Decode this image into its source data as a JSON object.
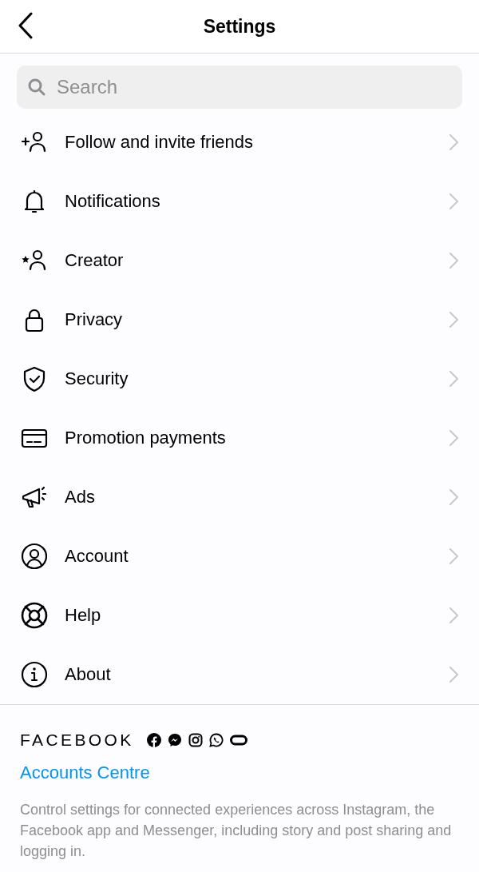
{
  "header": {
    "title": "Settings"
  },
  "search": {
    "placeholder": "Search"
  },
  "items": [
    {
      "label": "Follow and invite friends"
    },
    {
      "label": "Notifications"
    },
    {
      "label": "Creator"
    },
    {
      "label": "Privacy"
    },
    {
      "label": "Security"
    },
    {
      "label": "Promotion payments"
    },
    {
      "label": "Ads"
    },
    {
      "label": "Account"
    },
    {
      "label": "Help"
    },
    {
      "label": "About"
    }
  ],
  "footer": {
    "brand": "FACEBOOK",
    "link": "Accounts Centre",
    "description": "Control settings for connected experiences across Instagram, the Facebook app and Messenger, including story and post sharing and logging in."
  }
}
